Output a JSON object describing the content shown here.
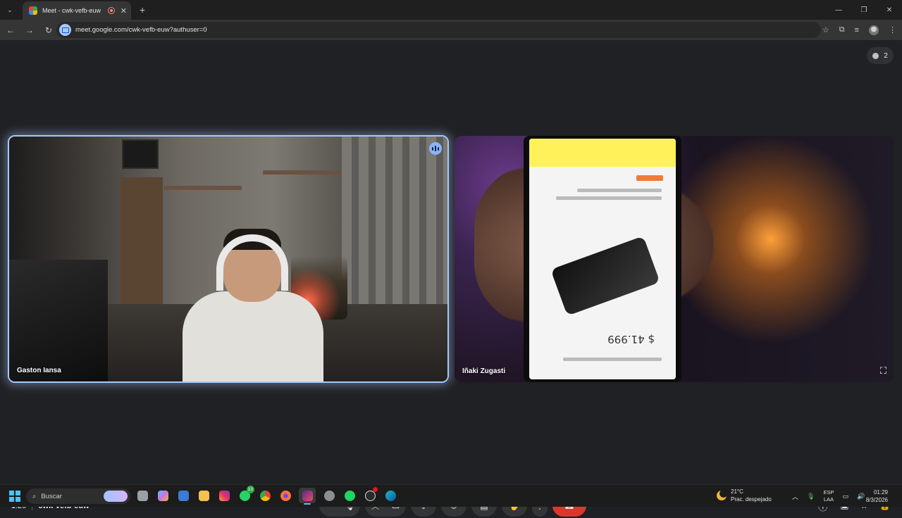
{
  "browser": {
    "tab_title": "Meet - cwk-vefb-euw",
    "url": "meet.google.com/cwk-vefb-euw?authuser=0"
  },
  "meet": {
    "participant_count": "2",
    "tiles": [
      {
        "name": "Gaston Iansa",
        "speaking": true
      },
      {
        "name": "Iñaki Zugasti",
        "speaking": false
      }
    ],
    "screen_content": {
      "price": "$ 41.999"
    },
    "time": "1:29",
    "meeting_code": "cwk-vefb-euw"
  },
  "taskbar": {
    "search_placeholder": "Buscar",
    "whatsapp_badge": "13",
    "weather": {
      "temp": "21°C",
      "condition": "Prac. despejado"
    },
    "language": {
      "top": "ESP",
      "bottom": "LAA"
    },
    "clock": {
      "time": "01:29",
      "date": "8/3/2026"
    }
  },
  "colors": {
    "accent": "#a8c7fa",
    "end_call": "#dc362e",
    "background": "#202124"
  }
}
